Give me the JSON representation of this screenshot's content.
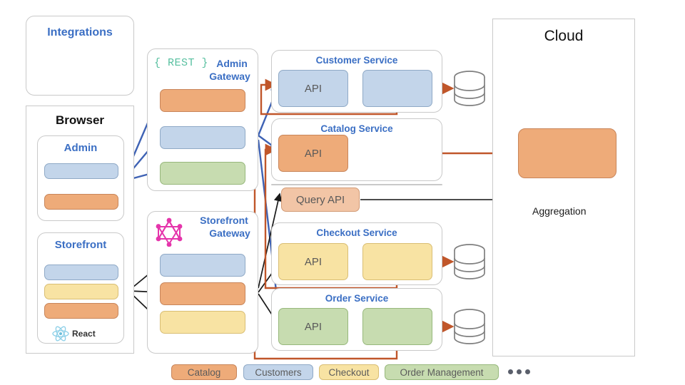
{
  "diagram": {
    "integrations": {
      "title": "Integrations"
    },
    "browser": {
      "title": "Browser",
      "admin": {
        "title": "Admin",
        "chips": [
          "Customers",
          "Catalog"
        ]
      },
      "storefront": {
        "title": "Storefront",
        "chips": [
          "Customers",
          "Checkout",
          "Catalog"
        ],
        "tech_label": "React",
        "tech_icon": "react-icon"
      }
    },
    "admin_gateway": {
      "title": "Admin\nGateway",
      "title_line1": "Admin",
      "title_line2": "Gateway",
      "badge": "{ REST }",
      "badge_icon": "rest-icon",
      "chips": [
        "Catalog",
        "Customers",
        "Order Management"
      ]
    },
    "storefront_gateway": {
      "title_line1": "Storefront",
      "title_line2": "Gateway",
      "badge_icon": "graphql-icon",
      "chips": [
        "Customers",
        "Catalog",
        "Checkout"
      ]
    },
    "services": [
      {
        "name": "Customer Service",
        "api_label": "API",
        "color": "blue",
        "has_second_box": true,
        "has_db": true
      },
      {
        "name": "Catalog Service",
        "api_label": "API",
        "color": "orange",
        "has_second_box": false,
        "has_db": false
      },
      {
        "name": "Checkout Service",
        "api_label": "API",
        "color": "yellow",
        "has_second_box": true,
        "has_db": true
      },
      {
        "name": "Order Service",
        "api_label": "API",
        "color": "green",
        "has_second_box": true,
        "has_db": true
      }
    ],
    "query_service": {
      "api_label": "Query API"
    },
    "cloud": {
      "title": "Cloud",
      "aggregation_label": "Aggregation"
    },
    "legend": [
      {
        "label": "Catalog",
        "color": "#eeab79"
      },
      {
        "label": "Customers",
        "color": "#c3d5ea"
      },
      {
        "label": "Checkout",
        "color": "#f8e3a3"
      },
      {
        "label": "Order Management",
        "color": "#c7dcb0"
      }
    ],
    "legend_more_icon": "ellipsis-icon",
    "colors": {
      "catalog": "#eeab79",
      "customers": "#c3d5ea",
      "checkout": "#f8e3a3",
      "order_management": "#c7dcb0",
      "event_bus_arrow": "#c0562a",
      "gateway_arrow": "#3e62b4",
      "query_arrow": "#1a1a1a",
      "title_text": "#3b6fc4",
      "rest_badge": "#58c0a0",
      "graphql_badge": "#e535ab"
    }
  }
}
